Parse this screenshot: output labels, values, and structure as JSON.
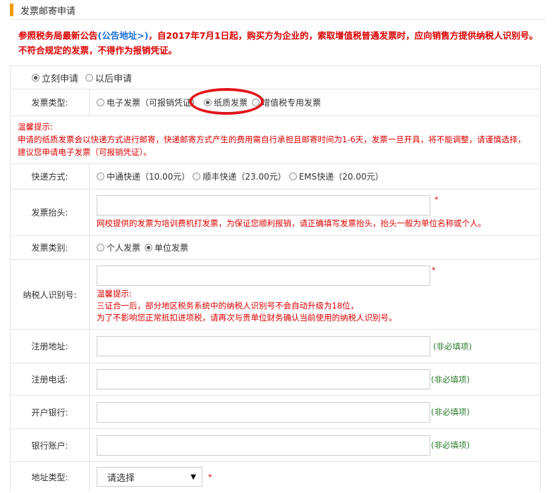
{
  "page": {
    "title": "发票邮寄申请"
  },
  "notice": {
    "prefix": "参照税务局最新公告",
    "link_text": "(公告地址>)",
    "suffix": "，自2017年7月1日起，购买方为企业的，索取增值税普通发票时，应向销售方提供纳税人识别号。不符合规定的发票，不得作为报销凭证。"
  },
  "apply_time": {
    "options": [
      {
        "label": "立刻申请",
        "selected": true
      },
      {
        "label": "以后申请",
        "selected": false
      }
    ]
  },
  "invoice_type": {
    "label": "发票类型:",
    "options": [
      {
        "label": "电子发票（可报销凭证）",
        "selected": false
      },
      {
        "label": "纸质发票",
        "selected": true
      },
      {
        "label": "增值税专用发票",
        "selected": false
      }
    ]
  },
  "warm_tip": {
    "title": "温馨提示:",
    "text": "申请的纸质发票会以快递方式进行邮寄，快递邮寄方式产生的费用需自行承担且邮寄时间为1-6天，发票一旦开具，将不能调整，请谨慎选择，建议您申请电子发票（可报销凭证）。"
  },
  "express": {
    "label": "快递方式:",
    "options": [
      {
        "label": "中通快递（10.00元）",
        "selected": false
      },
      {
        "label": "顺丰快递（23.00元）",
        "selected": false
      },
      {
        "label": "EMS快递（20.00元）",
        "selected": false
      }
    ]
  },
  "invoice_header": {
    "label": "发票抬头:",
    "value": "",
    "required_mark": "*",
    "note": "网校提供的发票为培训费机打发票，为保证您顺利报销，请正确填写发票抬头，抬头一般为单位名称或个人。"
  },
  "invoice_category": {
    "label": "发票类别:",
    "options": [
      {
        "label": "个人发票",
        "selected": false
      },
      {
        "label": "单位发票",
        "selected": true
      }
    ]
  },
  "taxpayer_id": {
    "label": "纳税人识别号:",
    "value": "",
    "required_mark": "*",
    "tip_title": "温馨提示:",
    "tip_line1": "三证合一后，部分地区税务系统中的纳税人识别号不会自动升级为18位，",
    "tip_line2": "为了不影响您正常抵扣进项税，请再次与贵单位财务确认当前使用的纳税人识别号。"
  },
  "reg_address": {
    "label": "注册地址:",
    "value": "",
    "optional": "(非必填项)"
  },
  "reg_phone": {
    "label": "注册电话:",
    "value": "",
    "optional": "(非必填项)"
  },
  "bank": {
    "label": "开户银行:",
    "value": "",
    "optional": "(非必填项)"
  },
  "account": {
    "label": "银行账户:",
    "value": "",
    "optional": "(非必填项)"
  },
  "address_type": {
    "label": "地址类型:",
    "selected": "请选择",
    "required_mark": "*"
  },
  "colors": {
    "accent": "#f39c12",
    "alert": "#dd0000",
    "link": "#1a6fd6",
    "optional": "#2a7a2a",
    "highlight": "#e2141b"
  }
}
